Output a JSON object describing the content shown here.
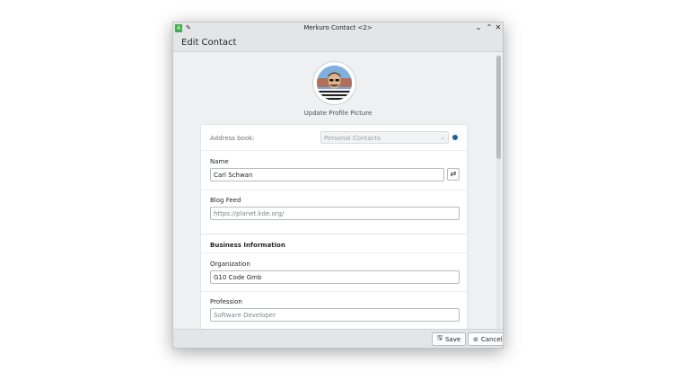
{
  "window": {
    "title": "Merkuro Contact <2>",
    "app_icon_glyph": "A",
    "controls": {
      "minimize": "⌄",
      "maximize": "⌃",
      "close": "✕"
    }
  },
  "header": {
    "title": "Edit Contact"
  },
  "avatar": {
    "caption": "Update Profile Picture"
  },
  "address_book": {
    "label": "Address book:",
    "selected": "Personal Contacts",
    "status_color": "#1d5fa8"
  },
  "name": {
    "label": "Name",
    "value": "Carl Schwan"
  },
  "blog_feed": {
    "label": "Blog Feed",
    "placeholder": "https://planet.kde.org/"
  },
  "business": {
    "title": "Business Information",
    "organization": {
      "label": "Organization",
      "value": "G10 Code Gmb"
    },
    "profession": {
      "label": "Profession",
      "placeholder": "Software Developer"
    }
  },
  "footer": {
    "save_label": "Save",
    "cancel_label": "Cancel"
  },
  "icons": {
    "pin": "pin-icon",
    "swap": "swap-icon",
    "save": "save-icon",
    "cancel": "cancel-icon"
  },
  "colors": {
    "accent": "#1d5fa8",
    "window_bg": "#eff0f1",
    "card_bg": "#ffffff"
  }
}
